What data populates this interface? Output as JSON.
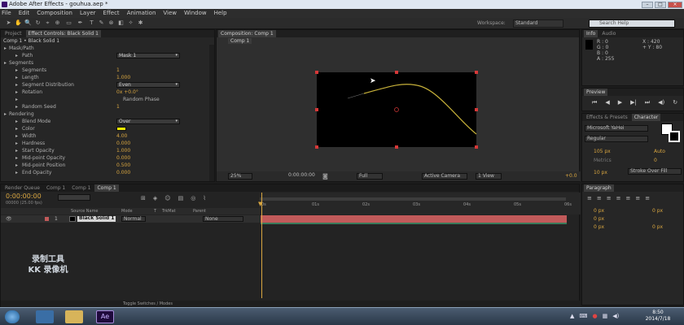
{
  "window": {
    "title": "Adobe After Effects - gouhua.aep *"
  },
  "menu": [
    "File",
    "Edit",
    "Composition",
    "Layer",
    "Effect",
    "Animation",
    "View",
    "Window",
    "Help"
  ],
  "toolbar": {
    "workspace_label": "Workspace:",
    "workspace_value": "Standard",
    "search_placeholder": "Search Help"
  },
  "project_panel": {
    "tabs": [
      "Project",
      "Effect Controls: Black Solid 1"
    ],
    "breadcrumb": "Comp 1 • Black Solid 1"
  },
  "effect_controls": {
    "rows": [
      {
        "label": "Mask/Path",
        "indent": 1,
        "value": ""
      },
      {
        "label": "Path",
        "indent": 2,
        "value": "Mask 1",
        "type": "dropdown"
      },
      {
        "label": "Segments",
        "indent": 1,
        "value": ""
      },
      {
        "label": "Segments",
        "indent": 2,
        "value": "1"
      },
      {
        "label": "Length",
        "indent": 2,
        "value": "1.000"
      },
      {
        "label": "Segment Distribution",
        "indent": 2,
        "value": "Even",
        "type": "dropdown"
      },
      {
        "label": "Rotation",
        "indent": 2,
        "value": "0x +0.0°"
      },
      {
        "label": "",
        "indent": 2,
        "value": "Random Phase",
        "type": "checkbox"
      },
      {
        "label": "Random Seed",
        "indent": 2,
        "value": "1"
      },
      {
        "label": "Rendering",
        "indent": 1,
        "value": ""
      },
      {
        "label": "Blend Mode",
        "indent": 2,
        "value": "Over",
        "type": "dropdown"
      },
      {
        "label": "Color",
        "indent": 2,
        "value": "",
        "type": "color"
      },
      {
        "label": "Width",
        "indent": 2,
        "value": "4.00"
      },
      {
        "label": "Hardness",
        "indent": 2,
        "value": "0.000"
      },
      {
        "label": "Start Opacity",
        "indent": 2,
        "value": "1.000"
      },
      {
        "label": "Mid-point Opacity",
        "indent": 2,
        "value": "0.000"
      },
      {
        "label": "Mid-point Position",
        "indent": 2,
        "value": "0.500"
      },
      {
        "label": "End Opacity",
        "indent": 2,
        "value": "0.000"
      }
    ]
  },
  "composition": {
    "tab": "Composition: Comp 1",
    "subtab": "Comp 1",
    "zoom": "25%",
    "timecode": "0:00:00:00",
    "resolution": "Full",
    "camera": "Active Camera",
    "views": "1 View",
    "exposure": "+0.0"
  },
  "info_panel": {
    "tabs": [
      "Info",
      "Audio"
    ],
    "r": "R : 0",
    "g": "G : 0",
    "b": "B : 0",
    "a": "A : 255",
    "x": "X : 420",
    "y": "+ Y : 80"
  },
  "preview_panel": {
    "title": "Preview"
  },
  "character_panel": {
    "tabs": [
      "Effects & Presets",
      "Character"
    ],
    "font": "Microsoft YaHei",
    "style": "Regular",
    "size": "105 px",
    "leading": "Auto",
    "tracking": "0",
    "kerning": "Metrics",
    "stroke_width": "10 px",
    "stroke_mode": "Stroke Over Fill"
  },
  "paragraph_panel": {
    "title": "Paragraph",
    "indent_left": "0 px",
    "indent_right": "0 px",
    "space_before": "0 px",
    "space_after": "0 px",
    "first_line": "0 px"
  },
  "timeline": {
    "tabs": [
      "Render Queue",
      "Comp 1",
      "Comp 1",
      "Comp 1"
    ],
    "timecode": "0:00:00:00",
    "fps": "00000 (25.00 fps)",
    "columns": [
      "Source Name",
      "Mode",
      "T",
      "TrkMat",
      "Parent"
    ],
    "layers": [
      {
        "num": "1",
        "name": "Black Solid 1",
        "mode": "Normal",
        "parent": "None"
      }
    ],
    "ruler": [
      "0s",
      "01s",
      "02s",
      "03s",
      "04s",
      "05s",
      "06s"
    ],
    "footer": "Toggle Switches / Modes"
  },
  "watermark": {
    "line1": "录制工具",
    "line2": "KK 录像机"
  },
  "taskbar": {
    "time": "8:50",
    "date": "2014/7/18"
  },
  "colors": {
    "accent_gold": "#d9a640",
    "layer_bar": "#c15a5a",
    "effect_color": "#f2ef00"
  }
}
